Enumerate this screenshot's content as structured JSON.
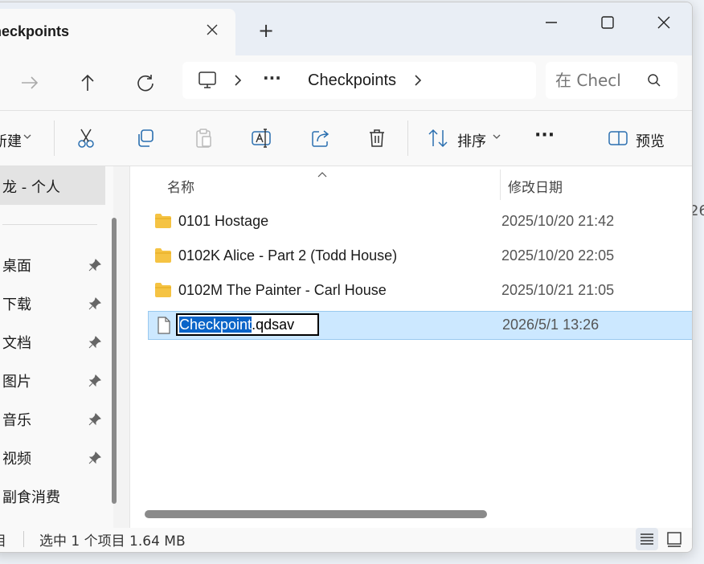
{
  "window": {
    "tab_title": "heckpoints",
    "new_tab_label": "+"
  },
  "address": {
    "ellipsis": "···",
    "current_folder": "Checkpoints",
    "search_placeholder": "在 Checl"
  },
  "toolbar": {
    "new_label": "新建",
    "sort_label": "排序",
    "more_label": "···",
    "preview_label": "预览"
  },
  "sidebar": {
    "header": "龙 - 个人",
    "items": [
      {
        "label": "桌面",
        "pinned": true
      },
      {
        "label": "下载",
        "pinned": true
      },
      {
        "label": "文档",
        "pinned": true
      },
      {
        "label": "图片",
        "pinned": true
      },
      {
        "label": "音乐",
        "pinned": true
      },
      {
        "label": "视频",
        "pinned": true
      },
      {
        "label": "副食消费",
        "pinned": false
      }
    ]
  },
  "columns": {
    "name": "名称",
    "date_modified": "修改日期"
  },
  "files": [
    {
      "name": "0101 Hostage",
      "date": "2025/10/20 21:42",
      "type": "folder"
    },
    {
      "name": "0102K Alice - Part 2 (Todd House)",
      "date": "2025/10/20 22:05",
      "type": "folder"
    },
    {
      "name": "0102M The Painter - Carl House",
      "date": "2025/10/21 21:05",
      "type": "folder"
    },
    {
      "name": "Checkpoint.qdsav",
      "date": "2026/5/1 13:26",
      "type": "file",
      "selected": true
    }
  ],
  "rename": {
    "selected_part": "Checkpoint",
    "extension": ".qdsav"
  },
  "status": {
    "count_fragment": "目",
    "selection_info": "选中 1 个项目  1.64 MB"
  },
  "background": {
    "fragment": "26"
  },
  "colors": {
    "selection": "#cce8ff",
    "selection_border": "#99c9ef",
    "folder": "#f5c343",
    "accent": "#0a64c8"
  }
}
